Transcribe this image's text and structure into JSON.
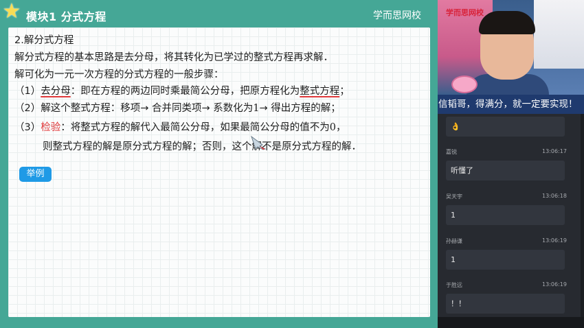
{
  "header": {
    "module_title": "模块1   分式方程",
    "brand": "学而思网校"
  },
  "lesson": {
    "section_title": "2.解分式方程",
    "line1": "解分式方程的基本思路是去分母，将其转化为已学过的整式方程再求解．",
    "line2": "解可化为一元一次方程的分式方程的一般步骤：",
    "step1": {
      "num": "（1）",
      "key": "去分母",
      "pre": "：即在方程的两边同时乘最简公分母，把原方程化为",
      "key2": "整式方程",
      "post": "；"
    },
    "step2": {
      "num": "（2）",
      "pre": "解这个整式方程：移项→ 合并同类项→ 系数化为",
      "one": "1",
      "post": "→ 得出方程的解；"
    },
    "step3": {
      "num": "（3）",
      "key": "检验",
      "pre": "：将整式方程的解代入最简公分母，如果最简公分母的值不为",
      "zero": "0",
      "post": "，",
      "cont": "则整式方程的解是原分式方程的解；否则，这个解不是原分式方程的解．"
    },
    "example_button": "举例"
  },
  "video": {
    "logo": "学而思网校",
    "slogan": "信韬哥，得满分，就一定要实现！"
  },
  "chat": [
    {
      "user": "",
      "time": "",
      "text": "👌"
    },
    {
      "user": "嘉锐",
      "time": "13:06:17",
      "text": "听懂了"
    },
    {
      "user": "吴天宇",
      "time": "13:06:18",
      "text": "1"
    },
    {
      "user": "孙赫谦",
      "time": "13:06:19",
      "text": "1"
    },
    {
      "user": "于胜远",
      "time": "13:06:19",
      "text": "！！"
    }
  ],
  "colors": {
    "teal": "#45a796",
    "accent_red": "#e0383a",
    "button_blue": "#1f9ae6",
    "chat_bg": "#272a30"
  }
}
